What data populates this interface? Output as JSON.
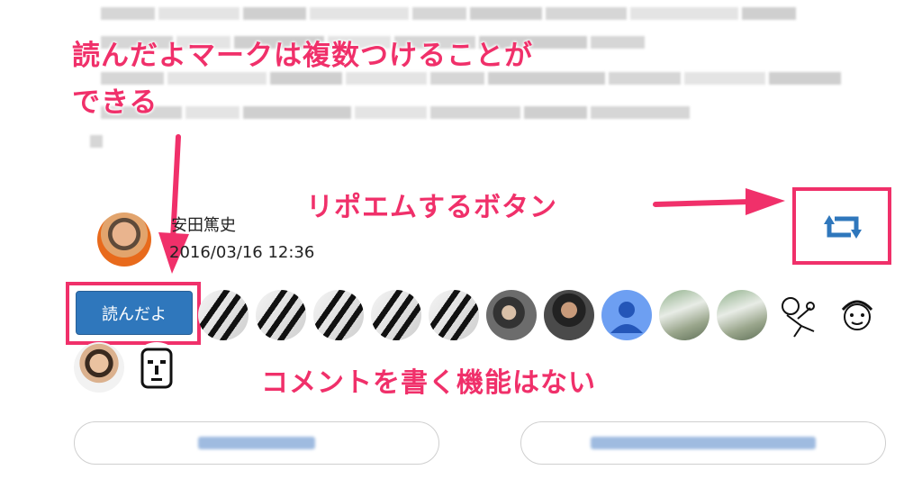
{
  "annotations": {
    "multiple_reads_line1": "読んだよマークは複数つけることが",
    "multiple_reads_line2": "できる",
    "repoem_button": "リポエムするボタン",
    "no_comment": "コメントを書く機能はない"
  },
  "post": {
    "author": "安田篤史",
    "date": "2016/03/16 12:36"
  },
  "actions": {
    "read_button_label": "読んだよ",
    "repoem_icon": "repost-icon"
  },
  "readers": [
    {
      "icon": "piano-avatar"
    },
    {
      "icon": "piano-avatar"
    },
    {
      "icon": "piano-avatar"
    },
    {
      "icon": "piano-avatar"
    },
    {
      "icon": "piano-avatar"
    },
    {
      "icon": "person-avatar"
    },
    {
      "icon": "person-avatar"
    },
    {
      "icon": "default-avatar"
    },
    {
      "icon": "waterfall-avatar"
    },
    {
      "icon": "waterfall-avatar"
    },
    {
      "icon": "sketch-avatar"
    },
    {
      "icon": "sketch-avatar"
    },
    {
      "icon": "person-avatar"
    },
    {
      "icon": "pixel-face-avatar"
    }
  ],
  "colors": {
    "annotation": "#f0306a",
    "button_blue": "#2f77bc"
  }
}
